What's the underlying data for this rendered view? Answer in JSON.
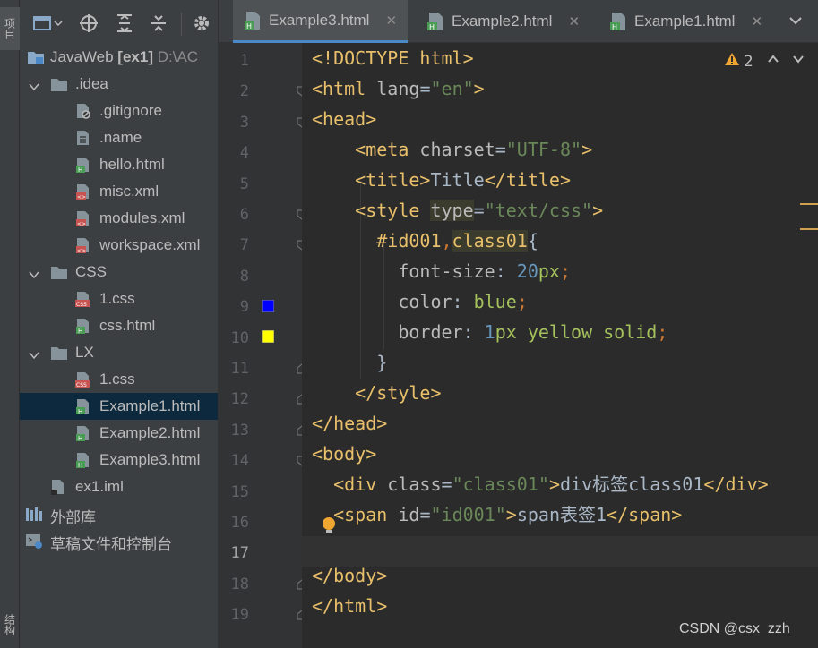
{
  "left_strip": {
    "project_label": "项目",
    "structure_label": "结构"
  },
  "toolbar": {
    "view_icon": "window-icon",
    "locate_icon": "crosshair-icon",
    "expand_icon": "expand-all-icon",
    "collapse_icon": "collapse-all-icon",
    "settings_icon": "gear-icon"
  },
  "tree": {
    "project_name": "JavaWeb",
    "module": "[ex1]",
    "path": "D:\\AC",
    "idea_folder": ".idea",
    "idea_files": [
      ".gitignore",
      ".name",
      "hello.html",
      "misc.xml",
      "modules.xml",
      "workspace.xml"
    ],
    "css_folder": "CSS",
    "css_files": [
      "1.css",
      "css.html"
    ],
    "lx_folder": "LX",
    "lx_files": [
      "1.css",
      "Example1.html",
      "Example2.html",
      "Example3.html"
    ],
    "iml": "ex1.iml",
    "external_libs": "外部库",
    "scratches": "草稿文件和控制台"
  },
  "tabs": [
    {
      "label": "Example3.html",
      "active": true
    },
    {
      "label": "Example2.html",
      "active": false
    },
    {
      "label": "Example1.html",
      "active": false
    }
  ],
  "editor": {
    "warning_count": "2",
    "current_line": "17",
    "line_numbers": [
      "1",
      "2",
      "3",
      "4",
      "5",
      "6",
      "7",
      "8",
      "9",
      "10",
      "11",
      "12",
      "13",
      "14",
      "15",
      "16",
      "17",
      "18",
      "19"
    ],
    "gutter_colors": {
      "line9": "#0000ff",
      "line10": "#ffff00"
    }
  },
  "code": {
    "l1a": "<!DOCTYPE",
    "l1b": " html>",
    "l2a": "<html",
    "l2b": " lang",
    "l2c": "=",
    "l2d": "\"en\"",
    "l2e": ">",
    "l3": "<head>",
    "l4a": "<meta",
    "l4b": " charset",
    "l4c": "=",
    "l4d": "\"UTF-8\"",
    "l4e": ">",
    "l5a": "<title>",
    "l5b": "Title",
    "l5c": "</title>",
    "l6a": "<style",
    "l6b": "type",
    "l6c": "=",
    "l6d": "\"text/css\"",
    "l6e": ">",
    "l7a": "#id001",
    "l7b": ",",
    "l7c": "class01",
    "l7d": "{",
    "l8a": "font-size",
    "l8b": ": ",
    "l8c": "20",
    "l8d": "px",
    "l8e": ";",
    "l9a": "color",
    "l9b": ": ",
    "l9c": "blue",
    "l9d": ";",
    "l10a": "border",
    "l10b": ": ",
    "l10c": "1",
    "l10d": "px yellow solid",
    "l10e": ";",
    "l11": "}",
    "l12": "</style>",
    "l13": "</head>",
    "l14": "<body>",
    "l15a": "<div",
    "l15b": " class",
    "l15c": "=",
    "l15d": "\"class01\"",
    "l15e": ">",
    "l15f": "div标签class01",
    "l15g": "</div>",
    "l16a": "<span",
    "l16b": " id",
    "l16c": "=",
    "l16d": "\"id001\"",
    "l16e": ">",
    "l16f": "span表签1",
    "l16g": "</span>",
    "l18": "</body>",
    "l19": "</html>"
  },
  "watermark": "CSDN @csx_zzh"
}
